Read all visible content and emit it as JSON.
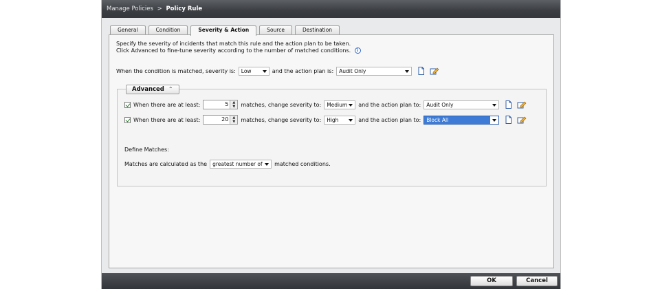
{
  "title": {
    "breadcrumb_parent": "Manage Policies",
    "separator": ">",
    "current": "Policy Rule"
  },
  "tabs": [
    {
      "label": "General"
    },
    {
      "label": "Condition"
    },
    {
      "label": "Severity & Action"
    },
    {
      "label": "Source"
    },
    {
      "label": "Destination"
    }
  ],
  "active_tab": "Severity & Action",
  "intro": {
    "line1": "Specify the severity of incidents that match this rule and the action plan to be taken.",
    "line2": "Click Advanced to fine-tune severity according to the number of matched conditions."
  },
  "main_rule": {
    "prefix": "When the condition is matched, severity is:",
    "severity": "Low",
    "middle": "and the action plan is:",
    "action_plan": "Audit Only"
  },
  "advanced": {
    "label": "Advanced",
    "rows": [
      {
        "checked": true,
        "prefix": "When there are at least:",
        "count": "5",
        "middle": "matches, change severity to:",
        "severity": "Medium",
        "suffix": "and the action plan to:",
        "action_plan": "Audit Only",
        "action_highlighted": false
      },
      {
        "checked": true,
        "prefix": "When there are at least:",
        "count": "20",
        "middle": "matches, change severity to:",
        "severity": "High",
        "suffix": "and the action plan to:",
        "action_plan": "Block All",
        "action_highlighted": true
      }
    ],
    "define_label": "Define Matches:",
    "matches_prefix": "Matches are calculated as the",
    "matches_select": "greatest number of",
    "matches_suffix": "matched conditions."
  },
  "buttons": {
    "ok": "OK",
    "cancel": "Cancel"
  },
  "colors": {
    "titlebar": "#3b3e43",
    "selection": "#3e7bd6",
    "panel": "#f7f7f7"
  }
}
